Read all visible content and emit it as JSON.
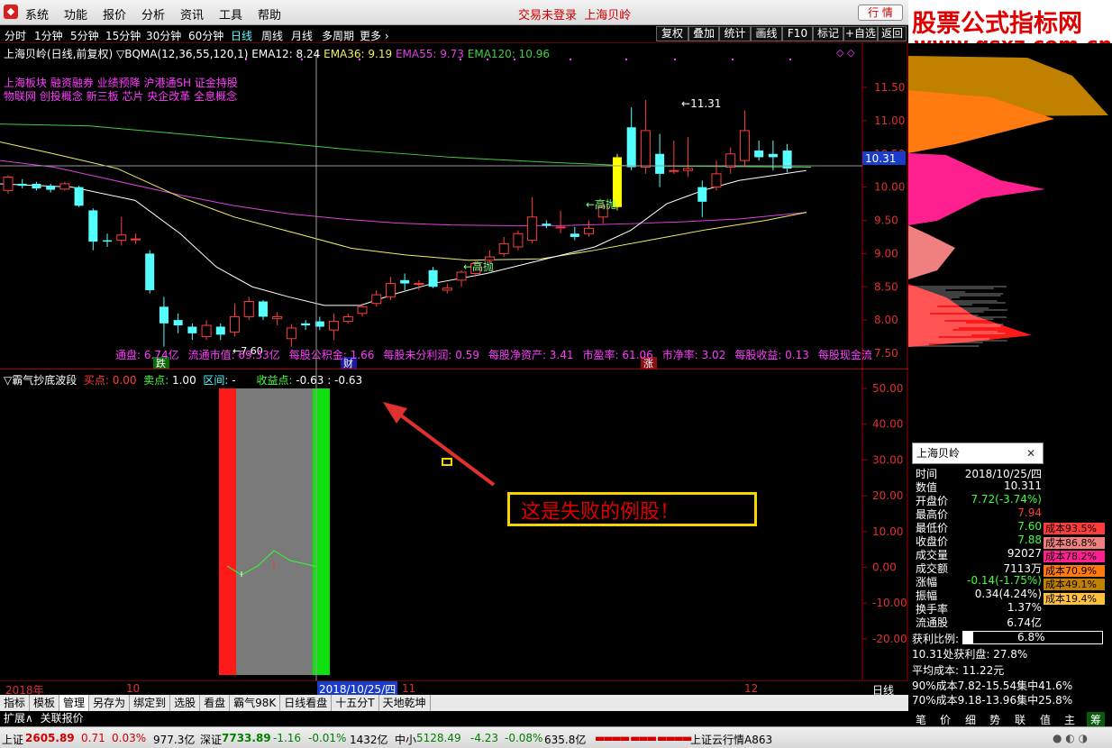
{
  "menu": {
    "items": [
      "系统",
      "功能",
      "报价",
      "分析",
      "资讯",
      "工具",
      "帮助"
    ],
    "status": "交易未登录",
    "stock": "上海贝岭",
    "quote_btn": "行  情"
  },
  "watermark": {
    "line1": "股票公式指标网",
    "line2": "www.gsxz.com.cn"
  },
  "toolbar": {
    "periods": [
      "分时",
      "1分钟",
      "5分钟",
      "15分钟",
      "30分钟",
      "60分钟",
      "日线",
      "周线",
      "月线",
      "多周期",
      "更多"
    ],
    "right": [
      "复权",
      "叠加",
      "统计",
      "画线",
      "F10",
      "标记",
      "+自选",
      "返回"
    ]
  },
  "main_chart": {
    "title": "上海贝岭(日线,前复权)",
    "indicator": "▽BQMA(12,36,55,120,1)",
    "ema12": "EMA12: 8.24",
    "ema36": "EMA36: 9.19",
    "ema55": "EMA55: 9.73",
    "ema120": "EMA120: 10.96",
    "tags1": "上海板块 融资融券 业绩预降 沪港通SH 证金持股",
    "tags2": "物联网 创投概念 新三板 芯片 央企改革 全息概念",
    "y_ticks": [
      "11.50",
      "11.00",
      "10.50",
      "10.00",
      "9.50",
      "9.00",
      "8.50",
      "8.00",
      "7.50"
    ],
    "crosshair_price": "10.31",
    "high_label": "11.31",
    "low_label": "7.60",
    "ann_high1": "←高抛",
    "ann_high2": "←高抛",
    "fin": [
      "通盘: 6.74亿",
      "流通市值: 69.33亿",
      "每股公积金: 1.66",
      "每股未分利润: 0.59",
      "每股净资产: 3.41",
      "市盈率: 61.06",
      "市净率: 3.02",
      "每股收益: 0.13",
      "每股现金流"
    ],
    "markers": [
      "跌",
      "财",
      "涨"
    ],
    "colors": {
      "up": "#ff3c3c",
      "down": "#54ffff",
      "ema12": "#ffffff",
      "ema36": "#f0f064",
      "ema55": "#e040e0",
      "ema120": "#40d040",
      "highlight": "#ffff00"
    }
  },
  "ind_chart": {
    "title": "▽霸气抄底波段",
    "buy_label": "买点:",
    "buy_val": "0.00",
    "sell_label": "卖点:",
    "sell_val": "1.00",
    "range_label": "区间:",
    "range_val": "-",
    "profit_label": "收益点:",
    "profit_val": "-0.63",
    "profit_val2": ": -0.63",
    "y_ticks": [
      "50.00",
      "40.00",
      "30.00",
      "20.00",
      "10.00",
      "0.00",
      "-10.00",
      "-20.00"
    ]
  },
  "annotation": "这是失败的例股！",
  "dates": {
    "year": "2018年",
    "m10": "10",
    "cursor": "2018/10/25/四",
    "m11": "11",
    "m12": "12",
    "period": "日线"
  },
  "tabs": [
    "指标",
    "模板",
    "管理",
    "另存为",
    "绑定到",
    "选股",
    "看盘",
    "霸气98K",
    "日线看盘",
    "十五分T",
    "天地乾坤"
  ],
  "ext": [
    "扩展∧",
    "关联报价"
  ],
  "popup": {
    "title": "上海贝岭",
    "rows": [
      [
        "时间",
        "2018/10/25/四"
      ],
      [
        "数值",
        "10.311"
      ],
      [
        "开盘价",
        "7.72(-3.74%)"
      ],
      [
        "最高价",
        "7.94"
      ],
      [
        "最低价",
        "7.60"
      ],
      [
        "收盘价",
        "7.88"
      ],
      [
        "成交量",
        "92027"
      ],
      [
        "成交额",
        "7113万"
      ],
      [
        "涨幅",
        "-0.14(-1.75%)"
      ],
      [
        "振幅",
        "0.34(4.24%)"
      ],
      [
        "换手率",
        "1.37%"
      ],
      [
        "流通股",
        "6.74亿"
      ]
    ]
  },
  "cost_bars": [
    {
      "label": "成本93.5%",
      "color": "#ff3c3c"
    },
    {
      "label": "成本86.8%",
      "color": "#f08080"
    },
    {
      "label": "成本78.2%",
      "color": "#ff2090"
    },
    {
      "label": "成本70.9%",
      "color": "#ff7a10"
    },
    {
      "label": "成本49.1%",
      "color": "#c08000"
    },
    {
      "label": "成本19.4%",
      "color": "#ffc040"
    }
  ],
  "profit": {
    "label": "获利比例:",
    "value": "6.8%",
    "avg_line": "10.31处获利盘: 27.8%",
    "avg_cost": "平均成本: 11.22元",
    "c90": "90%成本7.82-15.54集中41.6%",
    "c70": "70%成本9.18-13.96集中25.8%"
  },
  "rtabs": [
    "笔",
    "价",
    "细",
    "势",
    "联",
    "值",
    "主",
    "筹"
  ],
  "statusbar": {
    "sh_label": "上证",
    "sh": "2605.89",
    "sh_chg": "0.71",
    "sh_pct": "0.03%",
    "sh_amt": "977.3亿",
    "sz_label": "深证",
    "sz": "7733.89",
    "sz_chg": "-1.16",
    "sz_pct": "-0.01%",
    "sz_amt": "1432亿",
    "zx_label": "中小",
    "zx": "5128.49",
    "zx_chg": "-4.23",
    "zx_pct": "-0.08%",
    "zx_amt": "635.8亿",
    "cloud": "上证云行情A863"
  }
}
